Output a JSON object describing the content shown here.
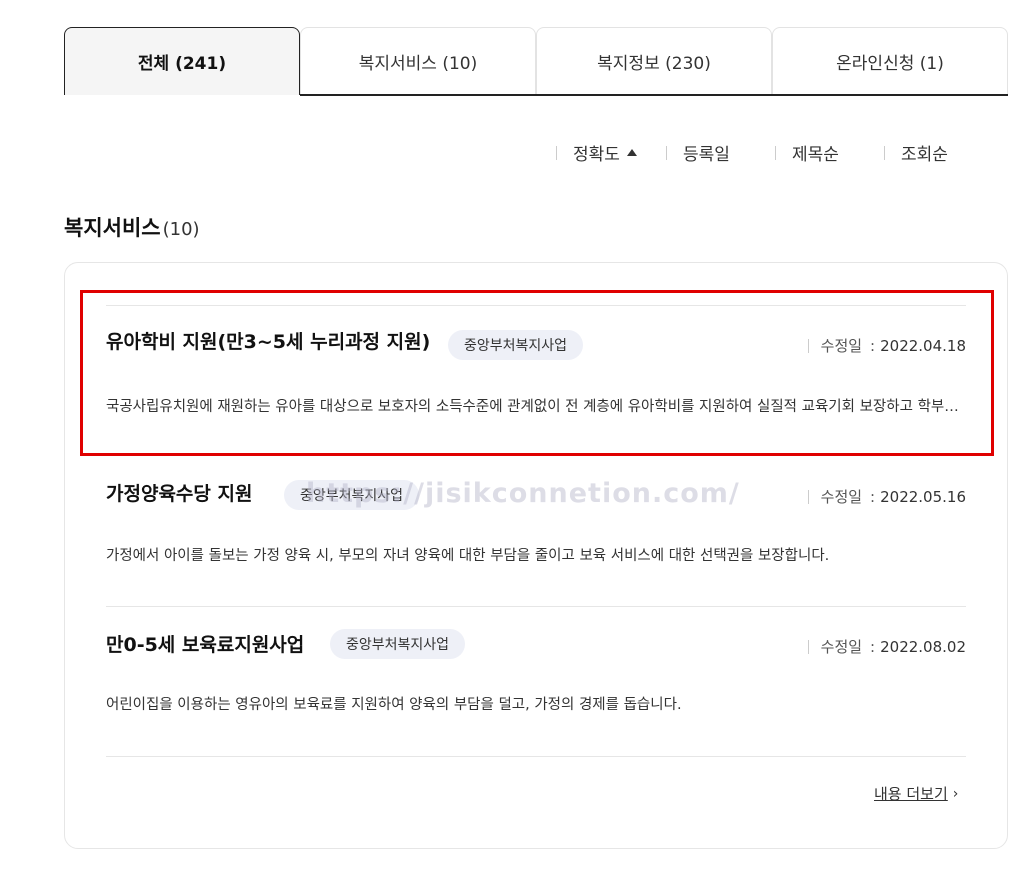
{
  "tabs": [
    {
      "label": "전체  (241)"
    },
    {
      "label": "복지서비스 (10)"
    },
    {
      "label": "복지정보 (230)"
    },
    {
      "label": "온라인신청 (1)"
    }
  ],
  "sort": {
    "accuracy": "정확도",
    "registered": "등록일",
    "title": "제목순",
    "views": "조회순"
  },
  "section": {
    "title": "복지서비스",
    "count": "(10)"
  },
  "items": [
    {
      "title": "유아학비 지원(만3~5세 누리과정 지원)",
      "tag": "중앙부처복지사업",
      "date_label": "수정일",
      "date": "2022.04.18",
      "desc": "국공사립유치원에 재원하는 유아를 대상으로 보호자의 소득수준에 관계없이 전 계층에 유아학비를 지원하여 실질적 교육기회 보장하고 학부모 부담을 경감합니다."
    },
    {
      "title": "가정양육수당 지원",
      "tag": "중앙부처복지사업",
      "date_label": "수정일",
      "date": "2022.05.16",
      "desc": "가정에서 아이를 돌보는 가정 양육 시, 부모의 자녀 양육에 대한 부담을 줄이고 보육 서비스에 대한 선택권을 보장합니다."
    },
    {
      "title": "만0-5세 보육료지원사업",
      "tag": "중앙부처복지사업",
      "date_label": "수정일",
      "date": "2022.08.02",
      "desc": "어린이집을 이용하는 영유아의 보육료를 지원하여 양육의 부담을 덜고, 가정의 경제를 돕습니다."
    }
  ],
  "more": {
    "label": "내용 더보기",
    "chevron": "›"
  },
  "watermark": "https://jisikconnetion.com/",
  "colors": {
    "highlight": "#e00000",
    "tag_bg": "#eef0f7"
  },
  "icons": {
    "sort_caret": "caret-up-icon",
    "more": "chevron-right-icon"
  }
}
